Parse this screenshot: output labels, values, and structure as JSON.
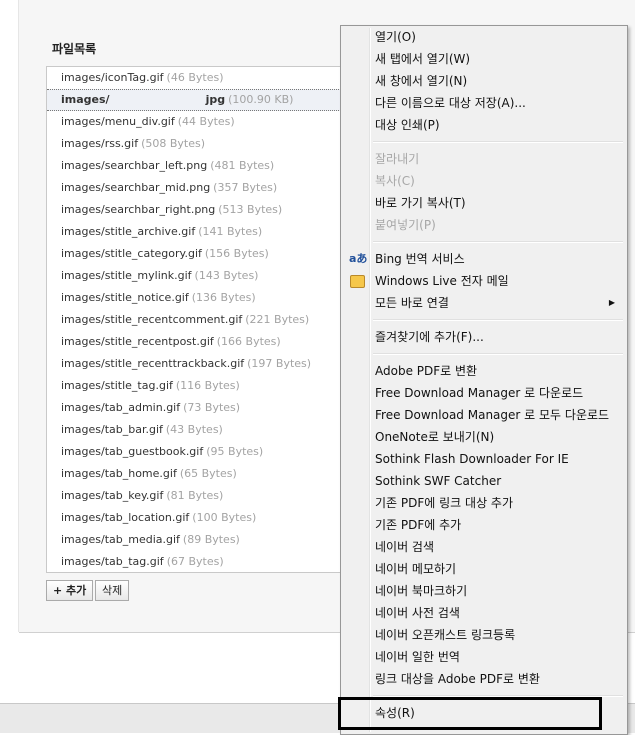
{
  "file_list": {
    "title": "파일목록",
    "items": [
      {
        "name": "images/iconTag.gif",
        "size": "(46 Bytes)"
      },
      {
        "name": "images/",
        "name_suffix": "jpg",
        "size": "(100.90 KB)",
        "selected": true
      },
      {
        "name": "images/menu_div.gif",
        "size": "(44 Bytes)"
      },
      {
        "name": "images/rss.gif",
        "size": "(508 Bytes)"
      },
      {
        "name": "images/searchbar_left.png",
        "size": "(481 Bytes)"
      },
      {
        "name": "images/searchbar_mid.png",
        "size": "(357 Bytes)"
      },
      {
        "name": "images/searchbar_right.png",
        "size": "(513 Bytes)"
      },
      {
        "name": "images/stitle_archive.gif",
        "size": "(141 Bytes)"
      },
      {
        "name": "images/stitle_category.gif",
        "size": "(156 Bytes)"
      },
      {
        "name": "images/stitle_mylink.gif",
        "size": "(143 Bytes)"
      },
      {
        "name": "images/stitle_notice.gif",
        "size": "(136 Bytes)"
      },
      {
        "name": "images/stitle_recentcomment.gif",
        "size": "(221 Bytes)"
      },
      {
        "name": "images/stitle_recentpost.gif",
        "size": "(166 Bytes)"
      },
      {
        "name": "images/stitle_recenttrackback.gif",
        "size": "(197 Bytes)"
      },
      {
        "name": "images/stitle_tag.gif",
        "size": "(116 Bytes)"
      },
      {
        "name": "images/tab_admin.gif",
        "size": "(73 Bytes)"
      },
      {
        "name": "images/tab_bar.gif",
        "size": "(43 Bytes)"
      },
      {
        "name": "images/tab_guestbook.gif",
        "size": "(95 Bytes)"
      },
      {
        "name": "images/tab_home.gif",
        "size": "(65 Bytes)"
      },
      {
        "name": "images/tab_key.gif",
        "size": "(81 Bytes)"
      },
      {
        "name": "images/tab_location.gif",
        "size": "(100 Bytes)"
      },
      {
        "name": "images/tab_media.gif",
        "size": "(89 Bytes)"
      },
      {
        "name": "images/tab_tag.gif",
        "size": "(67 Bytes)"
      }
    ],
    "add_button": "+ 추가",
    "delete_button": "삭제"
  },
  "context_menu": {
    "group1": [
      {
        "label": "열기(O)"
      },
      {
        "label": "새 탭에서 열기(W)"
      },
      {
        "label": "새 창에서 열기(N)"
      },
      {
        "label": "다른 이름으로 대상 저장(A)..."
      },
      {
        "label": "대상 인쇄(P)"
      }
    ],
    "group2": [
      {
        "label": "잘라내기",
        "disabled": true
      },
      {
        "label": "복사(C)",
        "disabled": true
      },
      {
        "label": "바로 가기 복사(T)"
      },
      {
        "label": "붙여넣기(P)",
        "disabled": true
      }
    ],
    "group3": [
      {
        "label": "Bing 번역 서비스",
        "icon": "bing-translate-icon",
        "icon_glyph": "aあ"
      },
      {
        "label": "Windows Live 전자 메일",
        "icon": "windows-live-mail-icon"
      },
      {
        "label": "모든 바로 연결",
        "submenu": true
      }
    ],
    "group4": [
      {
        "label": "즐겨찾기에 추가(F)..."
      }
    ],
    "group5": [
      {
        "label": "Adobe PDF로 변환"
      },
      {
        "label": "Free Download Manager 로 다운로드"
      },
      {
        "label": "Free Download Manager 로 모두 다운로드"
      },
      {
        "label": "OneNote로 보내기(N)"
      },
      {
        "label": "Sothink Flash Downloader For IE"
      },
      {
        "label": "Sothink SWF Catcher"
      },
      {
        "label": "기존 PDF에 링크 대상 추가"
      },
      {
        "label": "기존 PDF에 추가"
      },
      {
        "label": "네이버 검색"
      },
      {
        "label": "네이버 메모하기"
      },
      {
        "label": "네이버 북마크하기"
      },
      {
        "label": "네이버 사전 검색"
      },
      {
        "label": "네이버 오픈캐스트 링크등록"
      },
      {
        "label": "네이버 일한 번역"
      },
      {
        "label": "링크 대상을 Adobe PDF로 변환"
      }
    ],
    "group6": [
      {
        "label": "속성(R)"
      }
    ],
    "submenu_arrow": "▶"
  },
  "colors": {
    "menu_bg": "#f0f0f0",
    "disabled_text": "#a7a7a7",
    "file_size_text": "#a3a3a3",
    "highlight_border": "#000000"
  }
}
